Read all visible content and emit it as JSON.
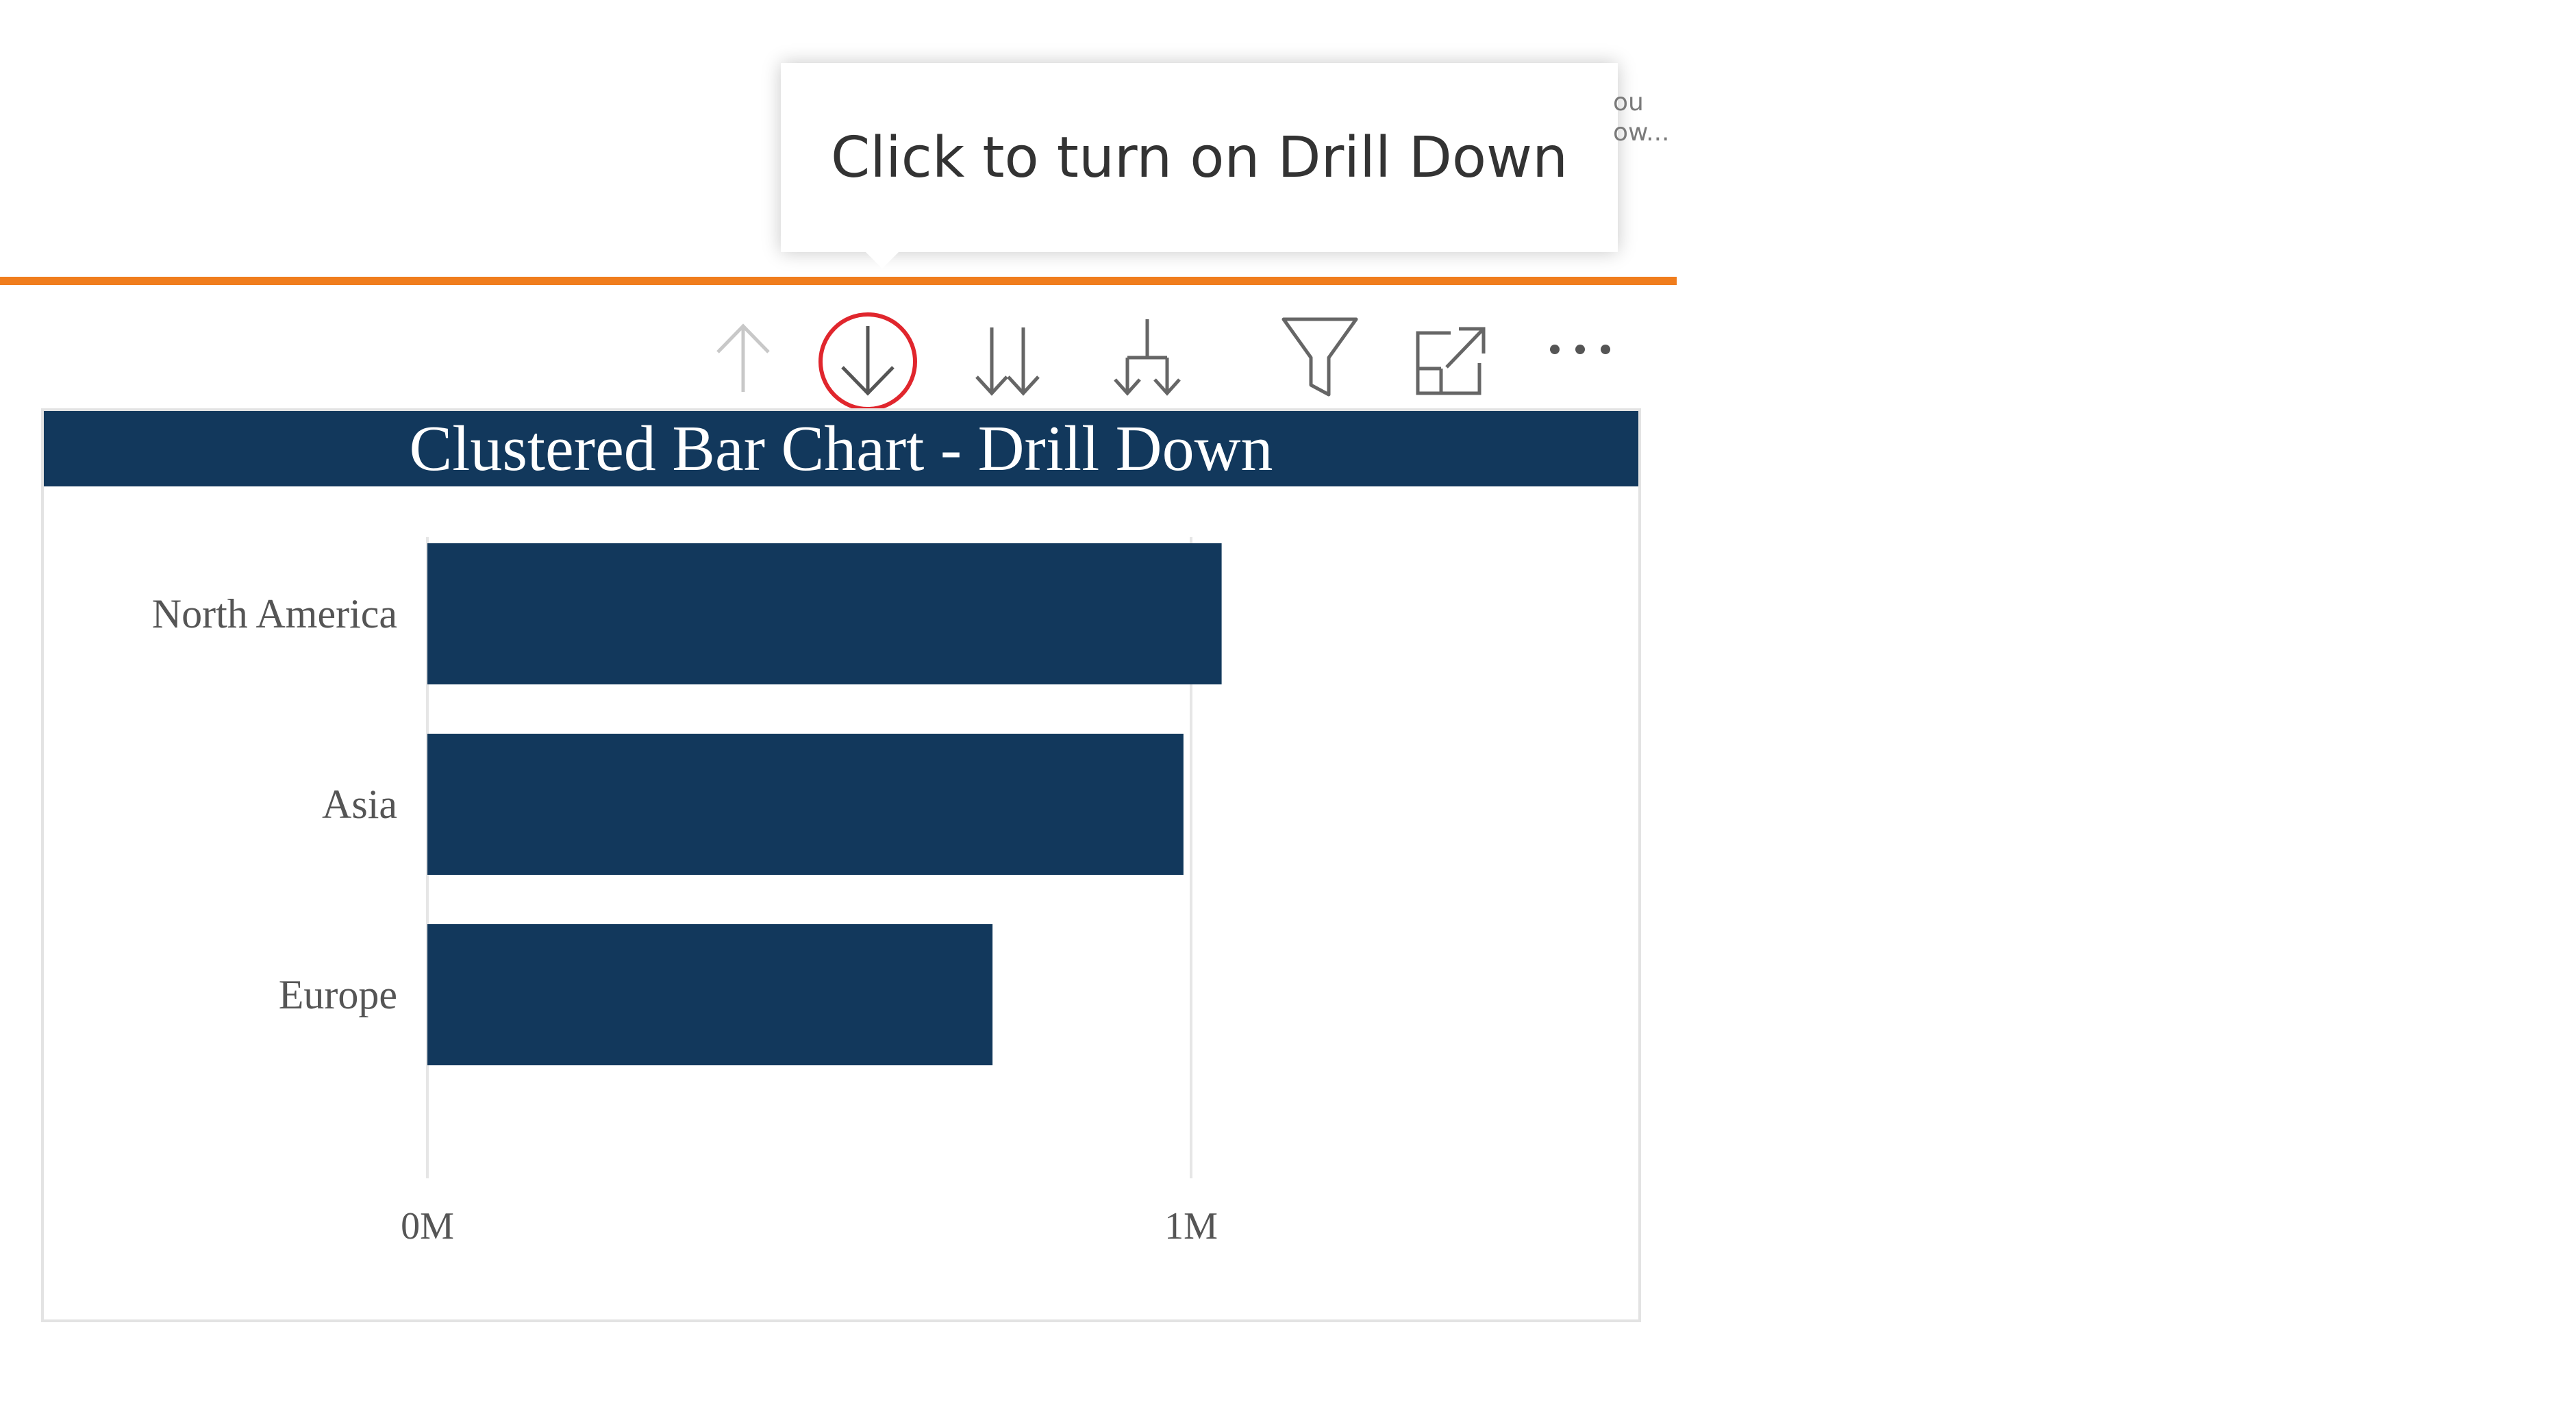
{
  "tooltip": {
    "text": "Click to turn on Drill Down"
  },
  "overflow_fragment": {
    "line1": "ou",
    "line2": "ow..."
  },
  "toolbar": {
    "items": [
      {
        "name": "drill-up-icon",
        "icon": "arrow-up",
        "state": "disabled"
      },
      {
        "name": "drill-down-icon",
        "icon": "arrow-down",
        "state": "highlighted"
      },
      {
        "name": "next-level-icon",
        "icon": "double-arrow-down",
        "state": "enabled"
      },
      {
        "name": "expand-hierarchy-icon",
        "icon": "fork-down",
        "state": "enabled"
      },
      {
        "name": "filter-icon",
        "icon": "funnel",
        "state": "enabled"
      },
      {
        "name": "focus-mode-icon",
        "icon": "expand",
        "state": "enabled"
      },
      {
        "name": "more-options-icon",
        "icon": "ellipsis",
        "state": "enabled"
      }
    ]
  },
  "colors": {
    "accent": "#f07d1d",
    "bar": "#12385c",
    "title_bg": "#12385c",
    "highlight_circle": "#e0262d",
    "icon": "#666666",
    "icon_disabled": "#c8c8c8"
  },
  "chart_data": {
    "type": "bar",
    "orientation": "horizontal",
    "title": "Clustered Bar Chart - Drill Down",
    "categories": [
      "North America",
      "Asia",
      "Europe"
    ],
    "values": [
      1.04,
      0.99,
      0.74
    ],
    "unit": "M",
    "xlim": [
      0,
      1.4
    ],
    "xticks": [
      0,
      1
    ],
    "xtick_labels": [
      "0M",
      "1M"
    ],
    "grid": true,
    "legend": "none"
  }
}
